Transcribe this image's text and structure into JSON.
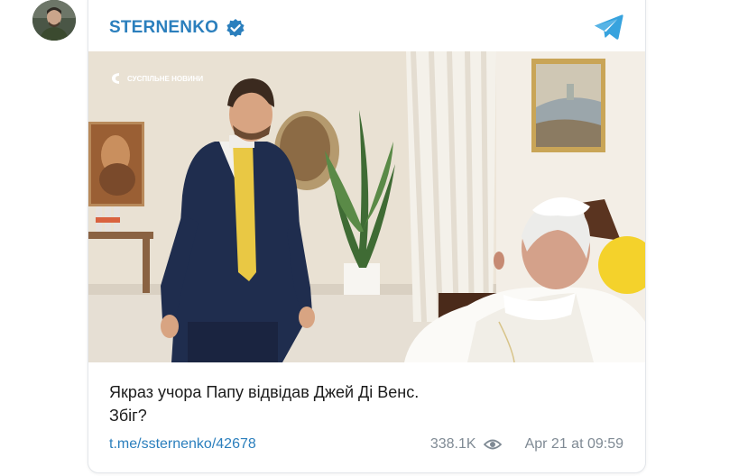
{
  "channel": {
    "name": "STERNENKO",
    "verified": true,
    "avatar_icon": "channel-avatar",
    "platform_icon": "telegram-icon",
    "accent_color": "#2b7fbd"
  },
  "post": {
    "image_watermark": "СУСПІЛЬНЕ НОВИНИ",
    "text_line1": "Якраз учора Папу відвідав Джей Ді Венс.",
    "text_line2": "Збіг?",
    "link": "t.me/ssternenko/42678",
    "views": "338.1K",
    "date": "Apr 21 at 09:59"
  }
}
